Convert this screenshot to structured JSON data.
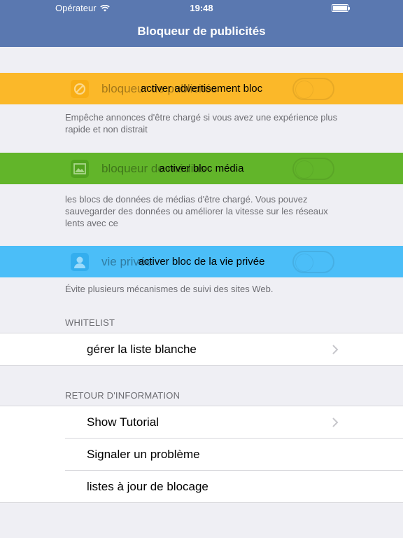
{
  "status_bar": {
    "carrier": "Opérateur",
    "time": "19:48"
  },
  "nav": {
    "title": "Bloqueur de publicités"
  },
  "banners": {
    "ads": {
      "text": "activer advertisement bloc",
      "ghost_label": "bloqueur de publicités",
      "icon": "block-icon",
      "color": "#fbb829"
    },
    "media": {
      "text": "activer bloc média",
      "ghost_label": "bloqueur de médias",
      "icon": "image-icon",
      "color": "#62b52a"
    },
    "privacy": {
      "text": "activer bloc de la vie privée",
      "ghost_label": "vie privée",
      "icon": "person-icon",
      "color": "#4bbef8"
    }
  },
  "descriptions": {
    "ads": "Empêche annonces d'être chargé si vous avez une expérience plus rapide et non distrait",
    "media": "les blocs de données de médias d'être chargé. Vous pouvez sauvegarder des données ou améliorer la vitesse sur les réseaux lents avec ce",
    "privacy": "Évite plusieurs mécanismes de suivi des sites Web."
  },
  "whitelist": {
    "header": "WHITELIST",
    "items": [
      {
        "label": "gérer la liste blanche"
      }
    ]
  },
  "feedback": {
    "header": "RETOUR D'INFORMATION",
    "items": [
      {
        "label": "Show Tutorial"
      },
      {
        "label": "Signaler un problème"
      },
      {
        "label": "listes à jour de blocage"
      }
    ]
  },
  "colors": {
    "nav": "#5a78b0",
    "background": "#efeff4"
  }
}
